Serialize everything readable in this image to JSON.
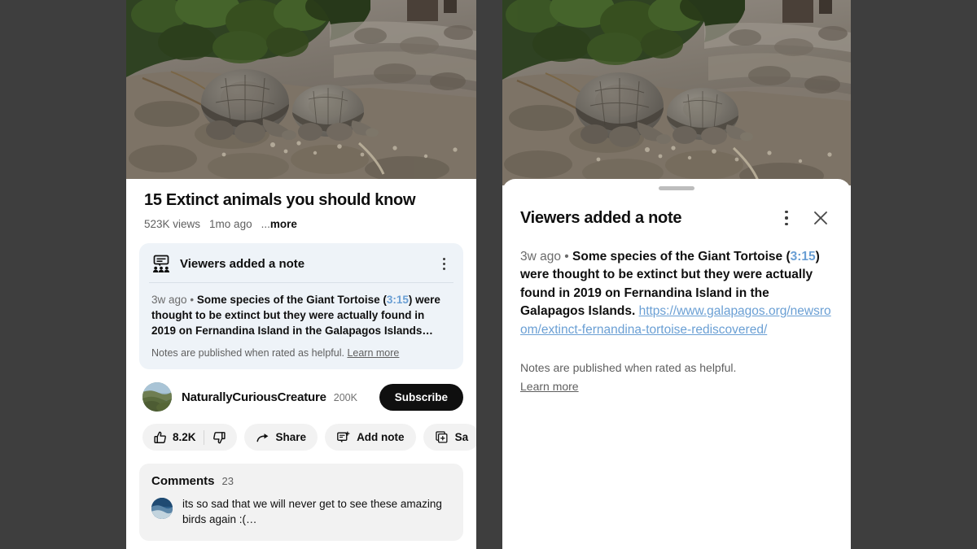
{
  "theme": {
    "page_background": "#3e3e3e",
    "surface": "#ffffff",
    "note_card_background": "#eef3f8",
    "pill_background": "#f2f2f2",
    "accent_link": "#6a9fd4",
    "primary_text": "#0f0f0f",
    "secondary_text": "#606060",
    "subscribe_background": "#0f0f0f"
  },
  "left_panel": {
    "thumbnail": {
      "alt": "Two Galapagos giant tortoises resting on rocky volcanic ground beside green shrubs"
    },
    "video": {
      "title": "15 Extinct animals you should know",
      "views": "523K views",
      "age": "1mo ago",
      "more_dots": "...",
      "more_label": "more"
    },
    "note_card": {
      "icon": "viewers-note-icon",
      "title": "Viewers added a note",
      "kebab_icon": "more-options-icon",
      "timestamp": "3w ago",
      "separator": "•",
      "body_before": "Some species of the Giant Tortoise (",
      "video_timestamp": "3:15",
      "body_after": ") were thought to be extinct but they were actually found in 2019 on Fernandina Island in the Galapagos Islands…",
      "footer_text": "Notes are published when rated as helpful.",
      "footer_link": "Learn more"
    },
    "channel": {
      "avatar_icon": "channel-avatar",
      "name": "NaturallyCuriousCreature",
      "subscribers": "200K",
      "subscribe_label": "Subscribe"
    },
    "actions": [
      {
        "name": "like",
        "icon": "thumbs-up-icon",
        "label": "8.2K"
      },
      {
        "name": "dislike",
        "icon": "thumbs-down-icon",
        "label": ""
      },
      {
        "name": "share",
        "icon": "share-arrow-icon",
        "label": "Share"
      },
      {
        "name": "add-note",
        "icon": "add-note-icon",
        "label": "Add note"
      },
      {
        "name": "save",
        "icon": "save-plus-icon",
        "label": "Sa"
      }
    ],
    "comments": {
      "title": "Comments",
      "count": "23",
      "items": [
        {
          "avatar_icon": "commenter-avatar",
          "text": "its so sad that we will never get to see these amazing birds again :(…"
        }
      ]
    }
  },
  "right_panel": {
    "thumbnail": {
      "alt": "Two Galapagos giant tortoises resting on rocky volcanic ground beside green shrubs"
    },
    "sheet": {
      "handle_icon": "drag-handle",
      "title": "Viewers added a note",
      "kebab_icon": "more-options-icon",
      "close_icon": "close-icon",
      "timestamp": "3w ago",
      "separator": "•",
      "body_before": "Some species of the Giant Tortoise (",
      "video_timestamp": "3:15",
      "body_middle": ") were thought to be extinct but they were actually found in 2019 on Fernandina Island in the Galapagos Islands. ",
      "url": "https://www.galapagos.org/newsroom/extinct-fernandina-tortoise-rediscovered/",
      "footer_text": "Notes are published when rated as helpful.",
      "footer_link": "Learn more"
    }
  }
}
